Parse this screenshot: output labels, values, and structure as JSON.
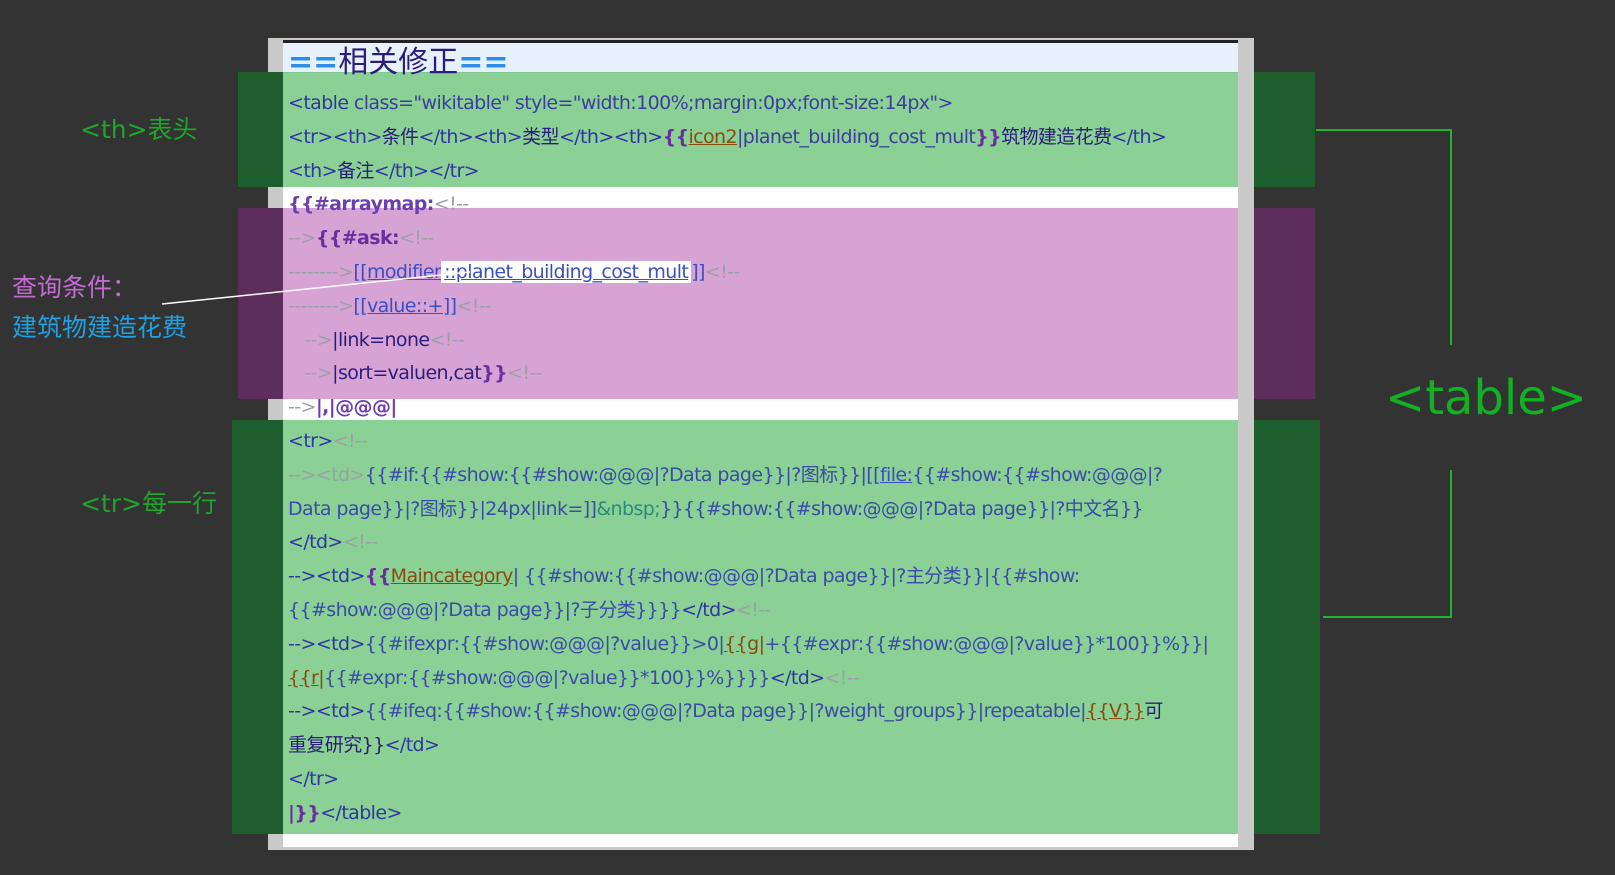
{
  "annotations": {
    "th_label": "<th>表头",
    "tr_label": "<tr>每一行",
    "query_label_line1": "查询条件：",
    "query_label_line2": "建筑物建造花费",
    "table_label": "<table>"
  },
  "colors": {
    "background": "#333333",
    "green_overlay": "#17a12a",
    "purple_overlay": "#a3339f",
    "annotation_green": "#1ea52a",
    "annotation_blue": "#1fa0e0",
    "annotation_purple": "#c46bd4"
  },
  "code": {
    "heading_eq_left": "==",
    "heading_text": "相关修正",
    "heading_eq_right": "==",
    "l1_open": "<table ",
    "l1_attr": "class=\"wikitable\" style=\"width:100%;margin:0px;font-size:14px\">",
    "l2_a": "<tr><th>",
    "l2_b": "条件",
    "l2_c": "</th><th>",
    "l2_d": "类型",
    "l2_e": "</th><th>",
    "l2_f": "{{",
    "l2_g": "icon2",
    "l2_h": "|planet_building_cost_mult",
    "l2_i": "}}",
    "l2_j": "筑物建造花费",
    "l2_k": "</th>",
    "l3_a": "<th>",
    "l3_b": "备注",
    "l3_c": "</th></tr>",
    "l4_a": "{{#arraymap:",
    "l4_b": "<!--",
    "l5_a": "-->",
    "l5_b": "{{#ask:",
    "l5_c": "<!--",
    "l6_a": "-------->",
    "l6_b": "[[modifier",
    "l6_c": "::planet_building_cost_mult",
    "l6_d": "]]",
    "l6_e": "<!--",
    "l7_a": "-------->",
    "l7_b": "[[value::+]]",
    "l7_c": "<!--",
    "l8_a": "   -->",
    "l8_b": "|link=none",
    "l8_c": "<!--",
    "l9_a": "   -->",
    "l9_b": "|sort=valuen,cat",
    "l9_c": "}}",
    "l9_d": "<!--",
    "l10_a": "-->",
    "l10_b": "|,|@@@|",
    "l11_a": "<tr>",
    "l11_b": "<!--",
    "l12_a": "--><td>",
    "l12_b": "{{#if:{{#show:{{#show:@@@|?Data page}}|?图标}}|[[",
    "l12_c": "file:",
    "l12_d": "{{#show:{{#show:@@@|?",
    "l13_a": "Data page}}|?图标}}|24px|link=]]",
    "l13_b": "&nbsp;",
    "l13_c": "}}{{#show:{{#show:@@@|?Data page}}|?中文名}}",
    "l14_a": "</td>",
    "l14_b": "<!--",
    "l15_a": "--><td>",
    "l15_b": "{{",
    "l15_c": "Maincategory",
    "l15_d": "| {{#show:{{#show:@@@|?Data page}}|?主分类}}|{{#show:",
    "l16_a": "{{#show:@@@|?Data page}}|?子分类}}}}",
    "l16_b": "</td>",
    "l16_c": "<!--",
    "l17_a": "--><td>",
    "l17_b": "{{#ifexpr:{{#show:@@@|?value}}>0|",
    "l17_c": "{{g|",
    "l17_d": "+{{#expr:{{#show:@@@|?value}}*100}}%}}|",
    "l18_a": "{{r|",
    "l18_b": "{{#expr:{{#show:@@@|?value}}*100}}%}}}}",
    "l18_c": "</td>",
    "l18_d": "<!--",
    "l19_a": "--><td>",
    "l19_b": "{{#ifeq:{{#show:{{#show:@@@|?Data page}}|?weight_groups}}|repeatable|",
    "l19_c": "{{V}}",
    "l19_d": "可",
    "l20_a": "重复研究}}",
    "l20_b": "</td>",
    "l21_a": "</tr>",
    "l22_a": "|}}",
    "l22_b": "</table>"
  }
}
